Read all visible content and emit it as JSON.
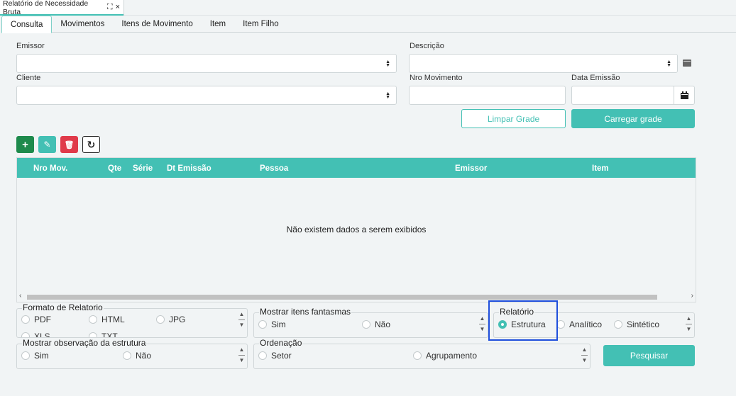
{
  "window": {
    "doc_tab_title": "Relatório de Necessidade Bruta",
    "expand_glyph": "⛶",
    "close_glyph": "×"
  },
  "tabs": [
    {
      "label": "Consulta",
      "active": true
    },
    {
      "label": "Movimentos"
    },
    {
      "label": "Itens de Movimento"
    },
    {
      "label": "Item"
    },
    {
      "label": "Item Filho"
    }
  ],
  "filters": {
    "emissor_label": "Emissor",
    "descricao_label": "Descrição",
    "cliente_label": "Cliente",
    "nro_movimento_label": "Nro Movimento",
    "data_emissao_label": "Data Emissão"
  },
  "buttons": {
    "limpar": "Limpar Grade",
    "carregar": "Carregar grade",
    "pesquisar": "Pesquisar"
  },
  "toolbar": {
    "add": "+",
    "edit": "✎",
    "delete": "🗑",
    "refresh": "↻"
  },
  "grid": {
    "columns": [
      "Nro Mov.",
      "Qte",
      "Série",
      "Dt Emissão",
      "Pessoa",
      "Emissor",
      "Item"
    ],
    "empty_message": "Não existem dados a serem exibidos"
  },
  "options": {
    "formato": {
      "legend": "Formato de Relatorio",
      "items": [
        "PDF",
        "HTML",
        "JPG",
        "XLS",
        "TXT"
      ]
    },
    "fantasmas": {
      "legend": "Mostrar itens fantasmas",
      "items": [
        "Sim",
        "Não"
      ]
    },
    "relatorio": {
      "legend": "Relatório",
      "items": [
        "Estrutura",
        "Analítico",
        "Sintético"
      ],
      "selected": "Estrutura"
    },
    "observacao": {
      "legend": "Mostrar observação da estrutura",
      "items": [
        "Sim",
        "Não"
      ]
    },
    "ordenacao": {
      "legend": "Ordenação",
      "items": [
        "Setor",
        "Agrupamento"
      ]
    }
  },
  "colors": {
    "accent": "#43c0b4",
    "add": "#1e8a4c",
    "delete": "#e03a4a",
    "highlight": "#1f4fdc"
  }
}
